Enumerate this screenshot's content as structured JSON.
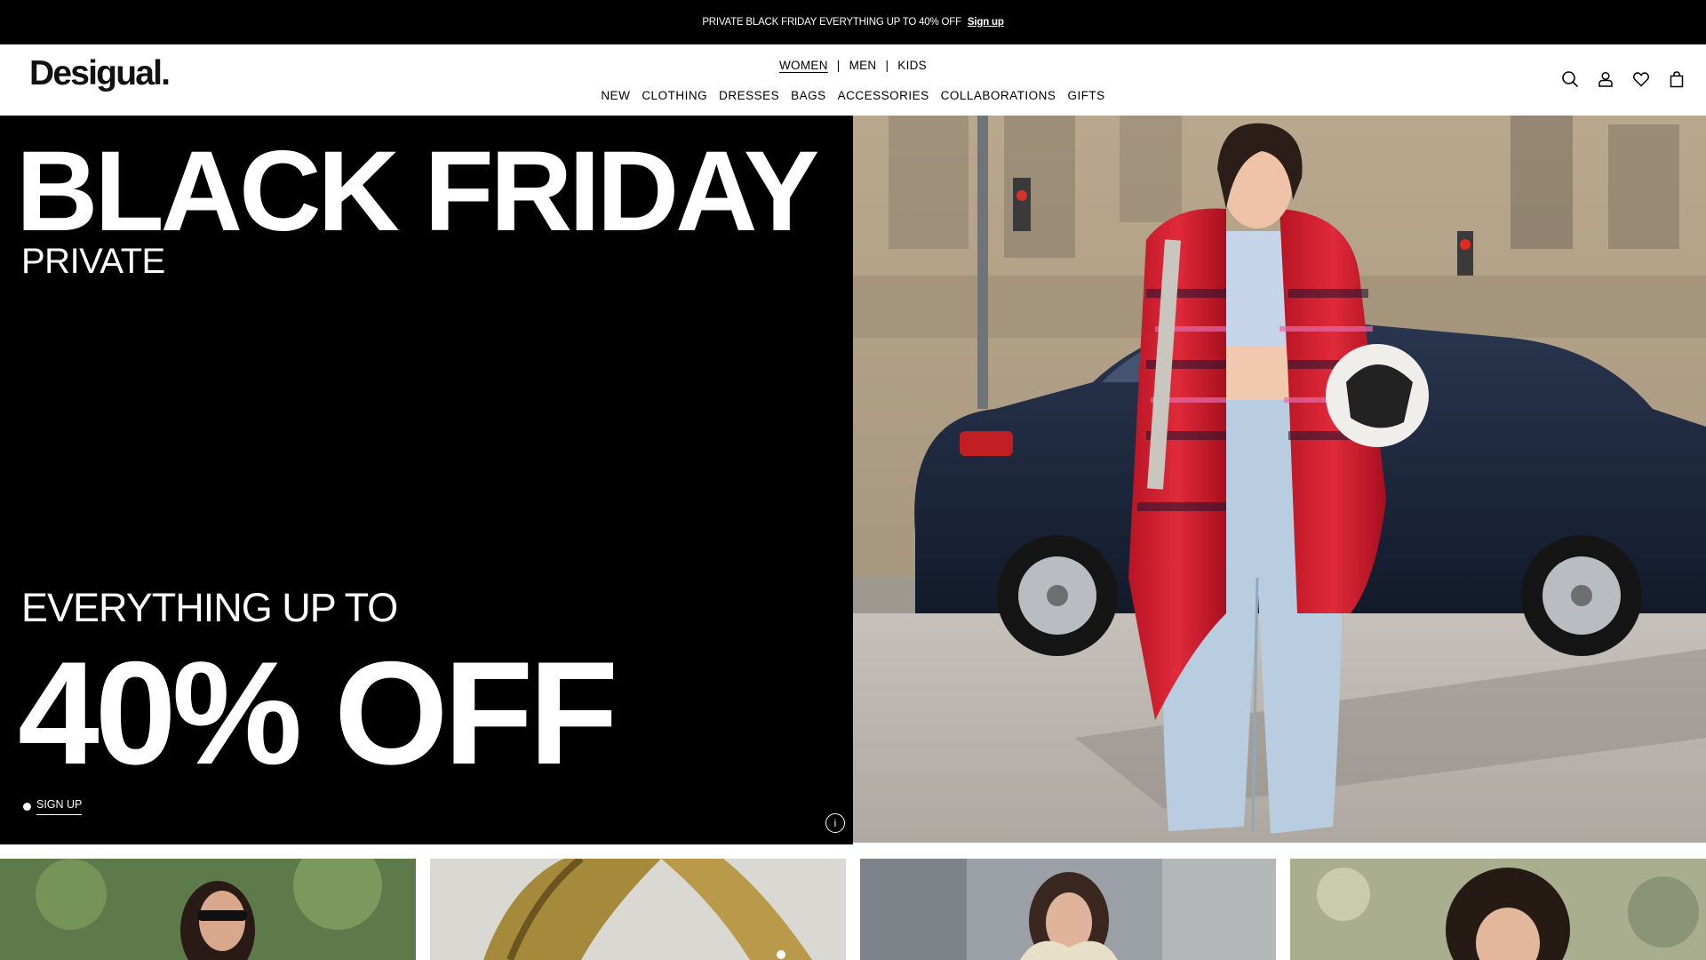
{
  "promo_bar": {
    "text": "PRIVATE BLACK FRIDAY EVERYTHING UP TO 40% OFF",
    "link": "Sign up"
  },
  "header": {
    "logo": "Desigual.",
    "gender_tabs": [
      {
        "label": "WOMEN",
        "active": true
      },
      {
        "label": "MEN",
        "active": false
      },
      {
        "label": "KIDS",
        "active": false
      }
    ],
    "separator": "|",
    "categories": [
      "NEW",
      "CLOTHING",
      "DRESSES",
      "BAGS",
      "ACCESSORIES",
      "COLLABORATIONS",
      "GIFTS"
    ],
    "icons": [
      "search-icon",
      "account-icon",
      "wishlist-heart-icon",
      "shopping-bag-icon"
    ]
  },
  "hero": {
    "title": "BLACK FRIDAY",
    "subtitle": "PRIVATE",
    "offer_line1": "EVERYTHING UP TO",
    "offer_line2": "40% OFF",
    "cta": "SIGN UP",
    "info_glyph": "i"
  },
  "colors": {
    "black": "#000000",
    "white": "#ffffff",
    "coat_red": "#d61c2c",
    "jeans_blue": "#b9cde0"
  }
}
